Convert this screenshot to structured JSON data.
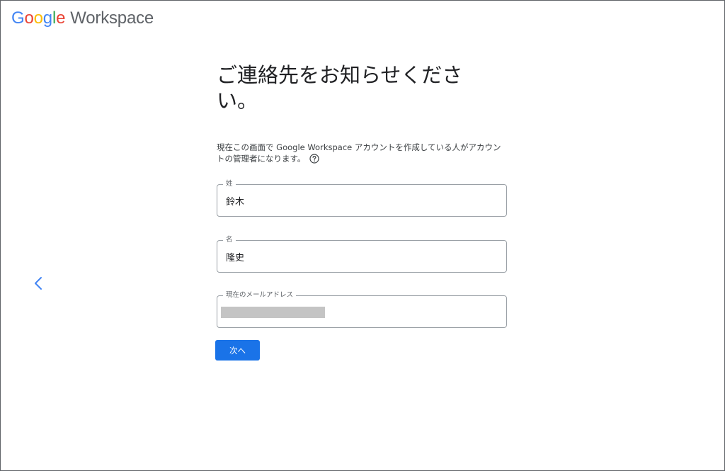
{
  "header": {
    "logo": {
      "g1": "G",
      "o1": "o",
      "o2": "o",
      "g2": "g",
      "l": "l",
      "e": "e",
      "product": "Workspace"
    }
  },
  "form": {
    "title": "ご連絡先をお知らせください。",
    "description": "現在この画面で Google Workspace アカウントを作成している人がアカウントの管理者になります。",
    "fields": [
      {
        "label": "姓",
        "value": "鈴木"
      },
      {
        "label": "名",
        "value": "隆史"
      },
      {
        "label": "現在のメールアドレス",
        "value": ""
      }
    ],
    "next_label": "次へ"
  },
  "icons": {
    "back": "chevron-left-icon",
    "help": "help-circle-icon"
  },
  "colors": {
    "primary": "#1a73e8",
    "google_blue": "#4285f4",
    "google_red": "#ea4335",
    "google_yellow": "#fbbc05",
    "google_green": "#34a853",
    "border": "#9aa0a6",
    "redaction": "#c4c4c4"
  }
}
